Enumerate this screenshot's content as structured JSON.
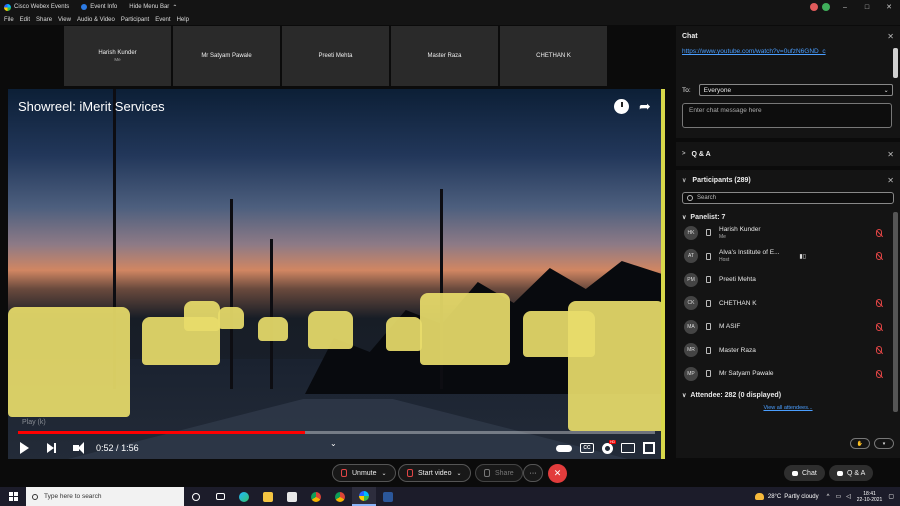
{
  "titlebar": {
    "app_name": "Cisco Webex Events",
    "event_info": "Event Info",
    "hide_menu": "Hide Menu Bar",
    "win_min": "–",
    "win_max": "□",
    "win_close": "✕"
  },
  "menubar": {
    "items": [
      "File",
      "Edit",
      "Share",
      "View",
      "Audio & Video",
      "Participant",
      "Event",
      "Help"
    ]
  },
  "strip": {
    "tiles": [
      {
        "name": "Harish Kunder",
        "sub": "Me"
      },
      {
        "name": "Mr Satyam Pawale",
        "sub": ""
      },
      {
        "name": "Preeti Mehta",
        "sub": ""
      },
      {
        "name": "Master Raza",
        "sub": ""
      },
      {
        "name": "CHETHAN K",
        "sub": ""
      }
    ]
  },
  "video": {
    "title": "Showreel: iMerit Services",
    "play_label": "Play (k)",
    "current_time": "0:52",
    "duration": "1:56",
    "time_separator": "/",
    "progress_fraction": 0.45,
    "share_glyph": "➦",
    "chevron_glyph": "⌄",
    "cc_label": "CC"
  },
  "chat": {
    "title": "Chat",
    "link": "https://www.youtube.com/watch?v=0ufzN6GND_c",
    "to_label": "To:",
    "to_value": "Everyone",
    "message_placeholder": "Enter chat message here"
  },
  "qa": {
    "title": "Q & A"
  },
  "participants": {
    "title": "Participants (289)",
    "search_placeholder": "Search",
    "panelist_group": "Panelist: 7",
    "panelists": [
      {
        "initials": "HK",
        "name": "Harish Kunder",
        "role": "Me",
        "muted": true
      },
      {
        "initials": "AT",
        "name": "Alva's Institute of E...",
        "role": "Host",
        "muted": true
      },
      {
        "initials": "PM",
        "name": "Preeti Mehta",
        "role": "",
        "muted": false
      },
      {
        "initials": "CK",
        "name": "CHETHAN K",
        "role": "",
        "muted": true
      },
      {
        "initials": "MA",
        "name": "M ASIF",
        "role": "",
        "muted": true
      },
      {
        "initials": "MR",
        "name": "Master Raza",
        "role": "",
        "muted": true
      },
      {
        "initials": "MP",
        "name": "Mr Satyam Pawale",
        "role": "",
        "muted": true
      }
    ],
    "attendee_group": "Attendee: 282 (0 displayed)",
    "view_all": "View all attendees..."
  },
  "bottombar": {
    "unmute": "Unmute",
    "start_video": "Start video",
    "share": "Share",
    "more": "···",
    "end": "✕",
    "chat": "Chat",
    "qa": "Q & A"
  },
  "taskbar": {
    "search_placeholder": "Type here to search",
    "temperature": "28°C",
    "weather": "Partly cloudy",
    "time": "18:41",
    "date": "22-10-2021"
  },
  "colors": {
    "accent_link": "#4a9eff",
    "muted_red": "#e04545",
    "end_red": "#e23c3c",
    "progress_red": "#ff0000"
  }
}
